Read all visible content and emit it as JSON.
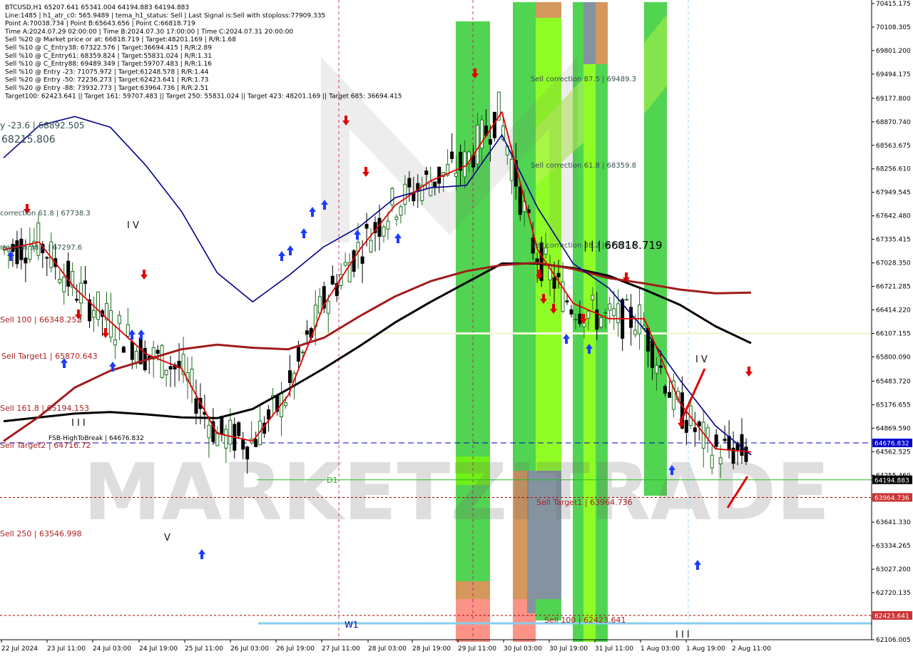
{
  "header": {
    "lines": [
      "BTCUSD,H1  65207.641 65341.004 64194.883 64194.883",
      "Line:1485 | h1_atr_c0: 565.9489 | tema_h1_status: Sell | Last Signal is:Sell with stoploss:77909.335",
      "Point A:70038.734 | Point B:65643.656 | Point C:66818.719",
      "Time A:2024.07.29 02:00:00 | Time B:2024.07.30 17:00:00 | Time C:2024.07.31 20:00:00",
      "Sell %20 @ Market price or at: 66818.719 | Target:48201.169 | R/R:1.68",
      "Sell %10 @ C_Entry38: 67322.576 | Target:36694.415 | R/R:2.89",
      "Sell %10 @ C_Entry61: 68359.824 | Target:55831.024 | R/R:1.31",
      "Sell %10 @ C_Entry88: 69489.349 | Target:59707.483 | R/R:1.16",
      "Sell %10 @ Entry -23: 71075.972 | Target:61248.578 | R/R:1.44",
      "Sell %20 @ Entry -50: 72236.273 | Target:62423.641 | R/R:1.73",
      "Sell %20 @ Entry -88: 73932.773 | Target:63964.736 | R/R:2.51",
      "Target100: 62423.641 || Target 161: 59707.483 || Target 250: 55831.024 || Target 423: 48201.169 || Target 685: 36694.415"
    ]
  },
  "watermark": "MARKETZITRADE",
  "colors": {
    "ma_black": "#000000",
    "ma_maroon": "#a01c1c",
    "ma_navy": "#00008b",
    "ma_red": "#e00000",
    "bull_candle": "#1e6e1e",
    "bear_candle": "#000000",
    "zone_green": "#32cd32",
    "zone_lime": "#7cfc00",
    "zone_orange": "#cd853f",
    "zone_pink": "#fa8072",
    "zone_gray": "#708090",
    "level_blue": "#0000cc",
    "level_green": "#22bb22",
    "level_red": "#aa0000",
    "w1_line": "#87ceeb",
    "h4_line": "#f5f5dc"
  },
  "chart_data": {
    "type": "candlestick",
    "symbol": "BTCUSD",
    "timeframe": "H1",
    "ylim": [
      62106.005,
      70415.175
    ],
    "y_ticks": [
      "70415.175",
      "70108.305",
      "69801.200",
      "69494.175",
      "69177.800",
      "68870.740",
      "68563.675",
      "68256.610",
      "67949.545",
      "67642.480",
      "67335.415",
      "67028.350",
      "66721.285",
      "66414.220",
      "66107.155",
      "65800.090",
      "65483.720",
      "65176.655",
      "64869.590",
      "64562.525",
      "64255.460",
      "63948.395",
      "63641.330",
      "63334.265",
      "63027.200",
      "62720.135",
      "62413.070",
      "62106.005"
    ],
    "x_ticks": [
      "22 Jul 2024",
      "23 Jul 11:00",
      "24 Jul 03:00",
      "24 Jul 19:00",
      "25 Jul 11:00",
      "26 Jul 03:00",
      "26 Jul 19:00",
      "27 Jul 11:00",
      "28 Jul 03:00",
      "28 Jul 19:00",
      "29 Jul 11:00",
      "30 Jul 03:00",
      "30 Jul 19:00",
      "31 Jul 11:00",
      "1 Aug 03:00",
      "1 Aug 19:00",
      "2 Aug 11:00"
    ],
    "price_tags": [
      {
        "label": "64676.832",
        "value": 64676.832,
        "color": "#0000cc"
      },
      {
        "label": "64194.883",
        "value": 64194.883,
        "color": "#000000"
      },
      {
        "label": "63964.736",
        "value": 63964.736,
        "color": "#cc3333"
      },
      {
        "label": "62423.641",
        "value": 62423.641,
        "color": "#cc3333"
      }
    ],
    "levels": [
      {
        "label": "FSB-HighToBreak | 64676.832",
        "value": 64676.832,
        "style": "dash",
        "color": "#0000cc"
      },
      {
        "label": "D1",
        "value": 64194.883,
        "style": "solid",
        "color": "#22bb22"
      },
      {
        "label": "Sell Target1 | 63964.736",
        "value": 63964.736,
        "style": "dot",
        "color": "#aa0000"
      },
      {
        "label": "Sell 100 | 62423.641",
        "value": 62423.641,
        "style": "dot",
        "color": "#aa0000"
      },
      {
        "label": "H4",
        "value": 66107.155,
        "style": "solid",
        "color": "#f5f5dc"
      },
      {
        "label": "W1",
        "value": 62320.0,
        "style": "solid",
        "color": "#87ceeb"
      }
    ],
    "annotations": [
      {
        "text": "y -23.6 | 68892.505",
        "value": 68892.505,
        "color": "#2f4f4f"
      },
      {
        "text": "68215.806",
        "value": 68640.0,
        "color": "#2f4f4f"
      },
      {
        "text": "correction 61.8 | 67738.3",
        "value": 67738.3,
        "color": "#2f4f4f"
      },
      {
        "text": "rrection 38.2 | 67297.6",
        "value": 67297.6,
        "color": "#2f4f4f"
      },
      {
        "text": "Sell 100 | 66348.252",
        "value": 66348.252,
        "color": "#aa2222"
      },
      {
        "text": "Sell Target1 | 65870.643",
        "value": 65870.643,
        "color": "#aa2222"
      },
      {
        "text": "Sell 161.8 | 65194.153",
        "value": 65194.153,
        "color": "#aa2222"
      },
      {
        "text": "Sell Target2 | 64716.72",
        "value": 64716.72,
        "color": "#aa2222"
      },
      {
        "text": "Sell 250 | 63546.998",
        "value": 63546.998,
        "color": "#aa2222"
      },
      {
        "text": "Sell correction 87.5 | 69489.3",
        "value": 69489.3,
        "color": "#2f4f4f"
      },
      {
        "text": "Sell correction 61.8 | 68359.8",
        "value": 68359.8,
        "color": "#2f4f4f"
      },
      {
        "text": "Sell correction 38.2 | 67322.6",
        "value": 67322.6,
        "color": "#2f4f4f"
      },
      {
        "text": "| | | 66818.719",
        "value": 66818.719,
        "color": "#000000"
      },
      {
        "text": "Sell Target1 | 63964.736",
        "value": 63964.736,
        "color": "#aa2222"
      },
      {
        "text": "Sell 100 | 62423.641",
        "value": 62423.641,
        "color": "#aa2222"
      }
    ],
    "wave_labels": [
      "I V",
      "I I I",
      "V",
      "I V",
      "I I I",
      "| | |"
    ],
    "series": [
      {
        "name": "MA black",
        "values": [
          64960,
          65010,
          65060,
          65080,
          65050,
          65010,
          65000,
          65120,
          65380,
          65650,
          65940,
          66250,
          66520,
          66770,
          67020,
          67020,
          66960,
          66860,
          66680,
          66480,
          66200,
          65980
        ]
      },
      {
        "name": "MA maroon",
        "values": [
          64700,
          65020,
          65400,
          65620,
          65760,
          65900,
          65960,
          65920,
          65900,
          66050,
          66330,
          66590,
          66790,
          66920,
          67000,
          67030,
          66950,
          66830,
          66760,
          66680,
          66630,
          66640
        ]
      },
      {
        "name": "MA navy",
        "values": [
          68400,
          68820,
          68940,
          68800,
          68300,
          67700,
          66900,
          66520,
          66860,
          67240,
          67500,
          67880,
          68010,
          68040,
          68700,
          67750,
          67020,
          66700,
          66160,
          65500,
          64900,
          64520
        ]
      },
      {
        "name": "MA red",
        "values": [
          67200,
          67300,
          66700,
          66260,
          65840,
          65650,
          64800,
          64700,
          65300,
          66480,
          67200,
          67780,
          68100,
          68300,
          69000,
          67200,
          66500,
          66300,
          66300,
          65200,
          64600,
          64560
        ]
      }
    ]
  }
}
